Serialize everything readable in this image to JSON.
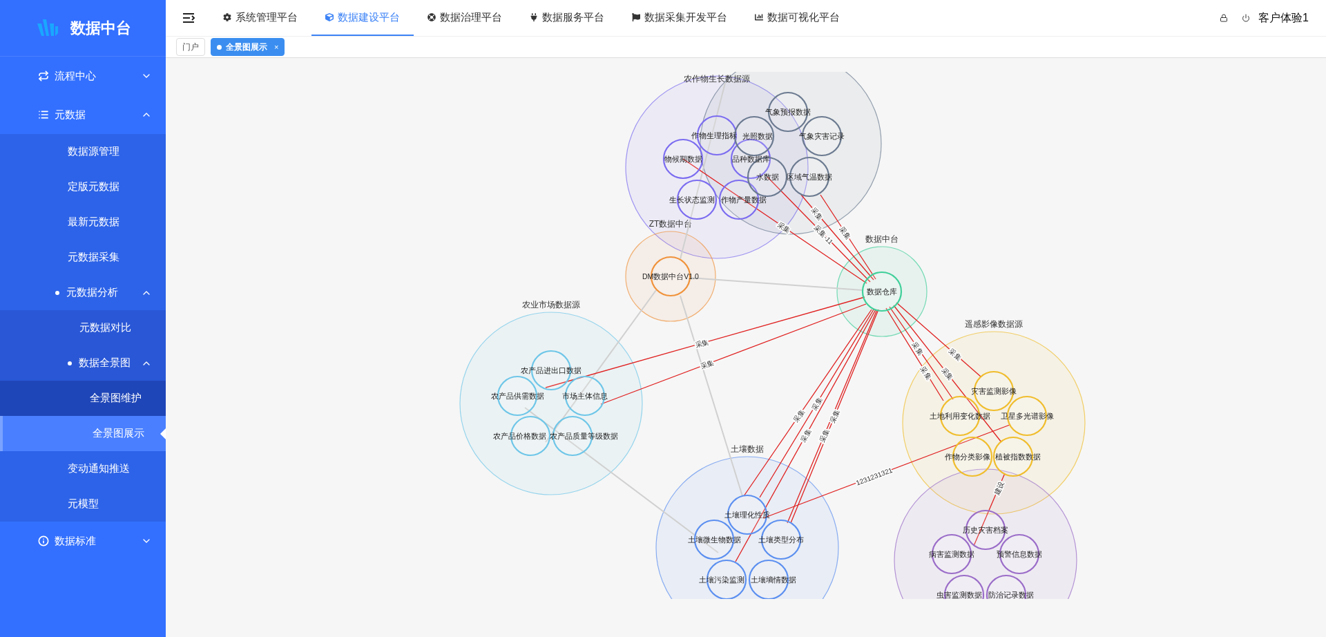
{
  "sidebar": {
    "brand": "数据中台",
    "menu": [
      {
        "label": "流程中心",
        "expanded": false,
        "selected": false
      },
      {
        "label": "元数据",
        "expanded": true,
        "selected": false,
        "children": [
          {
            "label": "数据源管理",
            "selected": false
          },
          {
            "label": "定版元数据",
            "selected": false
          },
          {
            "label": "最新元数据",
            "selected": false
          },
          {
            "label": "元数据采集",
            "selected": false
          },
          {
            "label": "元数据分析",
            "expanded": true,
            "selected": false,
            "children": [
              {
                "label": "元数据对比",
                "selected": false
              },
              {
                "label": "数据全景图",
                "expanded": true,
                "selected": false,
                "children": [
                  {
                    "label": "全景图维护",
                    "selected": false
                  },
                  {
                    "label": "全景图展示",
                    "selected": true
                  }
                ]
              }
            ]
          },
          {
            "label": "变动通知推送",
            "selected": false
          },
          {
            "label": "元模型",
            "selected": false
          }
        ]
      },
      {
        "label": "数据标准",
        "expanded": false,
        "selected": false
      }
    ]
  },
  "top_nav": {
    "tabs": [
      {
        "label": "系统管理平台",
        "selected": false
      },
      {
        "label": "数据建设平台",
        "selected": true
      },
      {
        "label": "数据治理平台",
        "selected": false
      },
      {
        "label": "数据服务平台",
        "selected": false
      },
      {
        "label": "数据采集开发平台",
        "selected": false
      },
      {
        "label": "数据可视化平台",
        "selected": false
      }
    ],
    "user": "客户体验1"
  },
  "tags": [
    {
      "label": "门户",
      "selected": false
    },
    {
      "label": "全景图展示",
      "selected": true,
      "close": "×"
    }
  ],
  "graph": {
    "groups": [
      {
        "title": "农作物生长数据源",
        "color": "#7b6cf0",
        "nodes": [
          {
            "label": "作物生理指标"
          },
          {
            "label": "物候期数据"
          },
          {
            "label": "品种数据库"
          },
          {
            "label": "生长状态监测"
          },
          {
            "label": "作物产量数据"
          }
        ]
      },
      {
        "color": "#6b7a90",
        "nodes": [
          {
            "label": "气象预报数据"
          },
          {
            "label": "光照数据"
          },
          {
            "label": "气象灾害记录"
          },
          {
            "label": "水数据"
          },
          {
            "label": "区域气温数据"
          }
        ]
      },
      {
        "title": "ZT数据中台",
        "color": "#f0923a",
        "nodes": [
          {
            "label": "DM数据中台V1.0"
          }
        ]
      },
      {
        "title": "数据中台",
        "color": "#3fcf9a",
        "nodes": [
          {
            "label": "数据仓库"
          }
        ]
      },
      {
        "title": "农业市场数据源",
        "color": "#6ec6e8",
        "nodes": [
          {
            "label": "农产品进出口数据"
          },
          {
            "label": "农产品供需数据"
          },
          {
            "label": "市场主体信息"
          },
          {
            "label": "农产品价格数据"
          },
          {
            "label": "农产品质量等级数据"
          }
        ]
      },
      {
        "title": "遥感影像数据源",
        "color": "#f0bd2c",
        "nodes": [
          {
            "label": "灾害监测影像"
          },
          {
            "label": "土地利用变化数据"
          },
          {
            "label": "卫星多光谱影像"
          },
          {
            "label": "作物分类影像"
          },
          {
            "label": "植被指数数据"
          }
        ]
      },
      {
        "title": "土壤数据",
        "color": "#5b8ff0",
        "nodes": [
          {
            "label": "土壤理化性质"
          },
          {
            "label": "土壤微生物数据"
          },
          {
            "label": "土壤类型分布"
          },
          {
            "label": "土壤污染监测"
          },
          {
            "label": "土壤墒情数据"
          }
        ]
      },
      {
        "color": "#9a6cc8",
        "nodes": [
          {
            "label": "历史灾害档案"
          },
          {
            "label": "病害监测数据"
          },
          {
            "label": "预警信息数据"
          },
          {
            "label": "虫害监测数据"
          },
          {
            "label": "防治记录数据"
          }
        ]
      }
    ],
    "edges": [
      {
        "label": "采集"
      },
      {
        "label": "采集-11"
      },
      {
        "label": "采集"
      },
      {
        "label": "采集"
      },
      {
        "label": "采集"
      },
      {
        "label": "采集"
      },
      {
        "label": "采集"
      },
      {
        "label": "采集"
      },
      {
        "label": "采集"
      },
      {
        "label": "采集"
      },
      {
        "label": "采集"
      },
      {
        "label": "采集"
      },
      {
        "label": "采集"
      },
      {
        "label": "采集"
      },
      {
        "label": "采集"
      },
      {
        "label": "1231231321"
      },
      {
        "label": "建设"
      }
    ]
  }
}
